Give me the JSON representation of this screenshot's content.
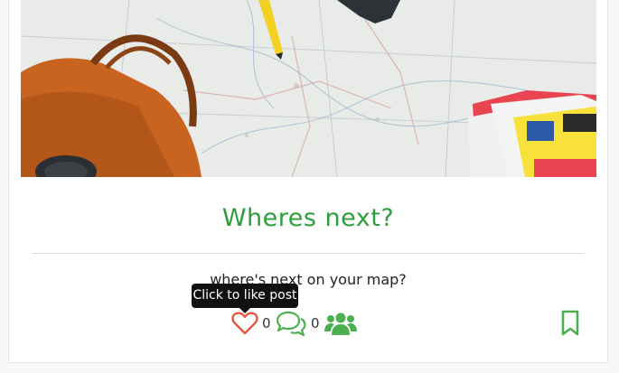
{
  "post": {
    "title": "Wheres next?",
    "description": "where's next on your map?"
  },
  "tooltip": {
    "text": "Click to like post"
  },
  "actions": {
    "likes_count": "0",
    "comments_count": "0",
    "like_icon": "heart-outline-icon",
    "comment_icon": "comments-icon",
    "group_icon": "users-icon",
    "bookmark_icon": "bookmark-icon"
  },
  "colors": {
    "title": "#2e9e3d",
    "like": "#e2583e",
    "icon": "#4caf50"
  }
}
